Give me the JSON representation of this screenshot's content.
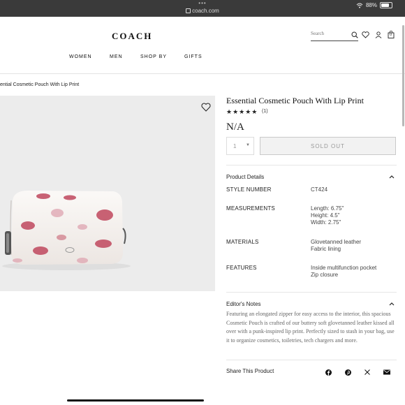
{
  "browser": {
    "dots": "•••",
    "url": "coach.com",
    "battery_percent": "88%",
    "battery_level": 0.88
  },
  "header": {
    "logo": "COACH",
    "search_placeholder": "Search",
    "cart_count": "0",
    "nav": [
      "WOMEN",
      "MEN",
      "SHOP BY",
      "GIFTS"
    ]
  },
  "breadcrumb": "ential Cosmetic Pouch With Lip Print",
  "product": {
    "title": "Essential Cosmetic Pouch With Lip Print",
    "stars": "★★★★★",
    "rating": 5,
    "review_count": "(1)",
    "price": "N/A",
    "quantity": "1",
    "sold_out_label": "SOLD OUT"
  },
  "details": {
    "section_title": "Product Details",
    "rows": [
      {
        "label": "STYLE NUMBER",
        "value": [
          "CT424"
        ]
      },
      {
        "label": "MEASUREMENTS",
        "value": [
          "Length: 6.75\"",
          "Height: 4.5\"",
          "Width: 2.75\""
        ]
      },
      {
        "label": "MATERIALS",
        "value": [
          "Glovetanned leather",
          "Fabric lining"
        ]
      },
      {
        "label": "FEATURES",
        "value": [
          "Inside multifunction pocket",
          "Zip closure"
        ]
      }
    ]
  },
  "editors_notes": {
    "section_title": "Editor's Notes",
    "text": "Featuring an elongated zipper for easy access to the interior, this spacious Cosmetic Pouch is crafted of our buttery soft glovetanned leather kissed all over with a punk-inspired lip print. Perfectly sized to stash in your bag, use it to organize cosmetics, toiletries, tech chargers and more."
  },
  "share": {
    "label": "Share This Product",
    "icons": [
      "facebook-icon",
      "pinterest-icon",
      "x-twitter-icon",
      "email-icon"
    ]
  },
  "colors": {
    "lip_print": "#c0485e",
    "pouch": "#f6f2ef",
    "image_bg": "#ececec"
  }
}
